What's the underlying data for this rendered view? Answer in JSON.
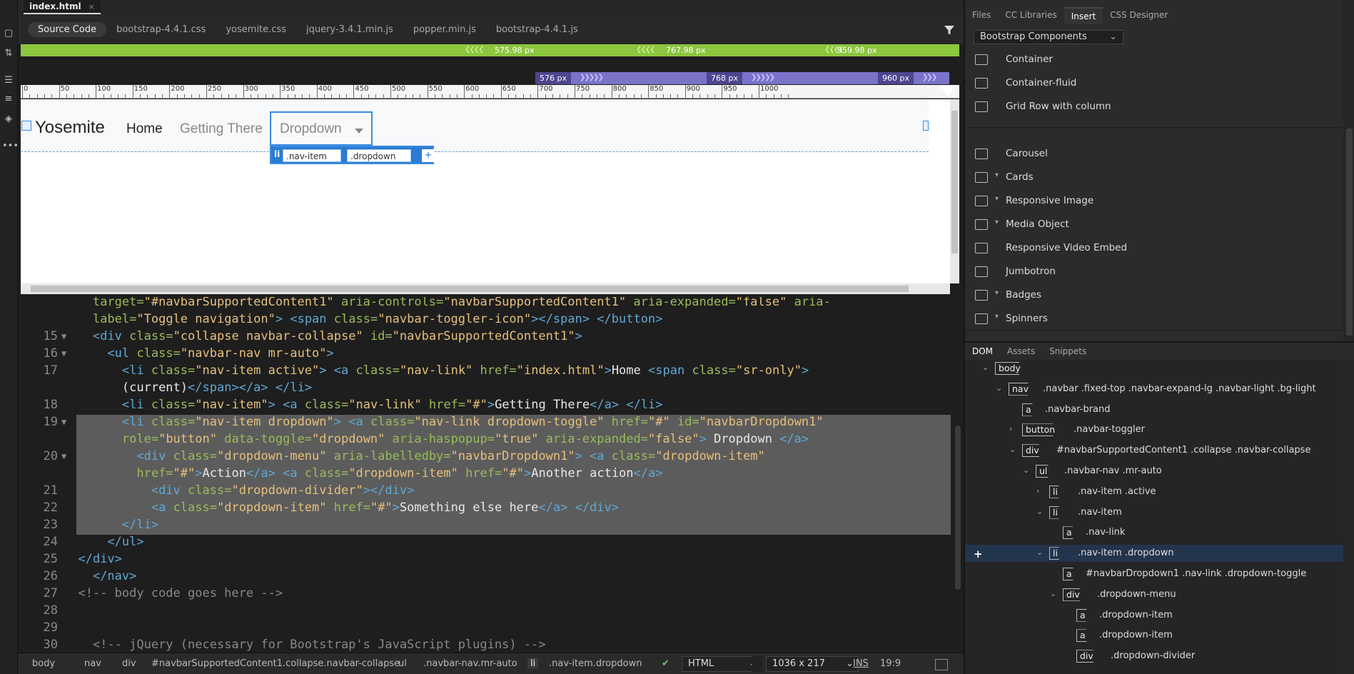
{
  "document": {
    "tab_title": "index.html",
    "close_glyph": "×"
  },
  "related_files": [
    "Source Code",
    "bootstrap-4.4.1.css",
    "yosemite.css",
    "jquery-3.4.1.min.js",
    "popper.min.js",
    "bootstrap-4.4.1.js"
  ],
  "media_queries": {
    "min_width": [
      "575.98  px",
      "767.98  px",
      "959.98  px"
    ],
    "max_width": [
      "576  px",
      "768  px",
      "960  px"
    ]
  },
  "ruler_labels": [
    "0",
    "50",
    "100",
    "150",
    "200",
    "250",
    "300",
    "350",
    "400",
    "450",
    "500",
    "550",
    "600",
    "650",
    "700",
    "750",
    "800",
    "850",
    "900",
    "950",
    "1000"
  ],
  "live_view": {
    "brand": "Yosemite",
    "nav": [
      "Home",
      "Getting There",
      "Dropdown"
    ],
    "hud": {
      "tag": "li",
      "classes": [
        ".nav-item",
        ".dropdown"
      ],
      "add": "+"
    }
  },
  "code_lines": [
    {
      "num": "",
      "fold": "",
      "html": "    <span class='at'>target=</span><span class='st'>\"#navbarSupportedContent1\"</span> <span class='at'>aria-controls=</span><span class='st'>\"navbarSupportedContent1\"</span> <span class='at'>aria-expanded=</span><span class='st'>\"false\"</span> <span class='at'>aria-</span>"
    },
    {
      "num": "",
      "fold": "",
      "html": "    <span class='at'>label=</span><span class='st'>\"Toggle navigation\"</span><span class='tg'>&gt;</span> <span class='tg'>&lt;span</span> <span class='at'>class=</span><span class='st'>\"navbar-toggler-icon\"</span><span class='tg'>&gt;&lt;/span&gt;</span> <span class='tg'>&lt;/button&gt;</span>"
    },
    {
      "num": "15",
      "fold": "▼",
      "html": "    <span class='tg'>&lt;div</span> <span class='at'>class=</span><span class='st'>\"collapse navbar-collapse\"</span> <span class='at'>id=</span><span class='st'>\"navbarSupportedContent1\"</span><span class='tg'>&gt;</span>"
    },
    {
      "num": "16",
      "fold": "▼",
      "html": "      <span class='tg'>&lt;ul</span> <span class='at'>class=</span><span class='st'>\"navbar-nav mr-auto\"</span><span class='tg'>&gt;</span>"
    },
    {
      "num": "17",
      "fold": "",
      "html": "        <span class='tg'>&lt;li</span> <span class='at'>class=</span><span class='st'>\"nav-item active\"</span><span class='tg'>&gt;</span> <span class='tg'>&lt;a</span> <span class='at'>class=</span><span class='st'>\"nav-link\"</span> <span class='at'>href=</span><span class='st'>\"index.html\"</span><span class='tg'>&gt;</span><span class='tx'>Home </span><span class='tg'>&lt;span</span> <span class='at'>class=</span><span class='st'>\"sr-only\"</span><span class='tg'>&gt;</span>"
    },
    {
      "num": "",
      "fold": "",
      "html": "        <span class='tx'>(current)</span><span class='tg'>&lt;/span&gt;&lt;/a&gt;</span> <span class='tg'>&lt;/li&gt;</span>"
    },
    {
      "num": "18",
      "fold": "",
      "html": "        <span class='tg'>&lt;li</span> <span class='at'>class=</span><span class='st'>\"nav-item\"</span><span class='tg'>&gt;</span> <span class='tg'>&lt;a</span> <span class='at'>class=</span><span class='st'>\"nav-link\"</span> <span class='at'>href=</span><span class='st'>\"#\"</span><span class='tg'>&gt;</span><span class='tx'>Getting There</span><span class='tg'>&lt;/a&gt;</span> <span class='tg'>&lt;/li&gt;</span>"
    },
    {
      "num": "19",
      "fold": "▼",
      "html": "        <span class='tg'>&lt;li</span> <span class='at'>class=</span><span class='st'>\"nav-item dropdown\"</span><span class='tg'>&gt;</span> <span class='tg'>&lt;a</span> <span class='at'>class=</span><span class='st'>\"nav-link dropdown-toggle\"</span> <span class='at'>href=</span><span class='st'>\"#\"</span> <span class='at'>id=</span><span class='st'>\"navbarDropdown1\"</span>"
    },
    {
      "num": "",
      "fold": "",
      "html": "        <span class='at'>role=</span><span class='st'>\"button\"</span> <span class='at'>data-toggle=</span><span class='st'>\"dropdown\"</span> <span class='at'>aria-haspopup=</span><span class='st'>\"true\"</span> <span class='at'>aria-expanded=</span><span class='st'>\"false\"</span><span class='tg'>&gt;</span><span class='tx'> Dropdown </span><span class='tg'>&lt;/a&gt;</span>"
    },
    {
      "num": "20",
      "fold": "▼",
      "html": "          <span class='tg'>&lt;div</span> <span class='at'>class=</span><span class='st'>\"dropdown-menu\"</span> <span class='at'>aria-labelledby=</span><span class='st'>\"navbarDropdown1\"</span><span class='tg'>&gt;</span> <span class='tg'>&lt;a</span> <span class='at'>class=</span><span class='st'>\"dropdown-item\"</span>"
    },
    {
      "num": "",
      "fold": "",
      "html": "          <span class='at'>href=</span><span class='st'>\"#\"</span><span class='tg'>&gt;</span><span class='tx'>Action</span><span class='tg'>&lt;/a&gt;</span> <span class='tg'>&lt;a</span> <span class='at'>class=</span><span class='st'>\"dropdown-item\"</span> <span class='at'>href=</span><span class='st'>\"#\"</span><span class='tg'>&gt;</span><span class='tx'>Another action</span><span class='tg'>&lt;/a&gt;</span>"
    },
    {
      "num": "21",
      "fold": "",
      "html": "            <span class='tg'>&lt;div</span> <span class='at'>class=</span><span class='st'>\"dropdown-divider\"</span><span class='tg'>&gt;&lt;/div&gt;</span>"
    },
    {
      "num": "22",
      "fold": "",
      "html": "            <span class='tg'>&lt;a</span> <span class='at'>class=</span><span class='st'>\"dropdown-item\"</span> <span class='at'>href=</span><span class='st'>\"#\"</span><span class='tg'>&gt;</span><span class='tx'>Something else here</span><span class='tg'>&lt;/a&gt;</span> <span class='tg'>&lt;/div&gt;</span>"
    },
    {
      "num": "23",
      "fold": "",
      "html": "        <span class='tg'>&lt;/li&gt;</span>"
    },
    {
      "num": "24",
      "fold": "",
      "html": "      <span class='tg'>&lt;/ul&gt;</span>"
    },
    {
      "num": "25",
      "fold": "",
      "html": "  <span class='tg'>&lt;/div&gt;</span>"
    },
    {
      "num": "26",
      "fold": "",
      "html": "    <span class='tg'>&lt;/nav&gt;</span>"
    },
    {
      "num": "27",
      "fold": "",
      "html": "  <span class='cm'>&lt;!-- body code goes here --&gt;</span>"
    },
    {
      "num": "28",
      "fold": "",
      "html": ""
    },
    {
      "num": "29",
      "fold": "",
      "html": ""
    },
    {
      "num": "30",
      "fold": "",
      "html": "    <span class='cm'>&lt;!-- jQuery (necessary for Bootstrap's JavaScript plugins) --&gt;</span>"
    }
  ],
  "status_bar": {
    "breadcrumbs": [
      "body",
      "nav",
      "div",
      "#navbarSupportedContent1.collapse.navbar-collapse",
      "ul",
      ".navbar-nav.mr-auto",
      "li",
      ".nav-item.dropdown"
    ],
    "language": "HTML",
    "window_size": "1036 x 217",
    "mode": "INS",
    "cursor": "19:9"
  },
  "right_panel": {
    "tabs": [
      "Files",
      "CC Libraries",
      "Insert",
      "CSS Designer"
    ],
    "active_tab": "Insert",
    "category": "Bootstrap Components",
    "components": [
      {
        "label": "Container",
        "twisty": ""
      },
      {
        "label": "Container-fluid",
        "twisty": ""
      },
      {
        "label": "Grid Row with column",
        "twisty": ""
      },
      {
        "label": "Carousel",
        "twisty": ""
      },
      {
        "label": "Cards",
        "twisty": "▾"
      },
      {
        "label": "Responsive Image",
        "twisty": "▾"
      },
      {
        "label": "Media Object",
        "twisty": "▾"
      },
      {
        "label": "Responsive Video Embed",
        "twisty": ""
      },
      {
        "label": "Jumbotron",
        "twisty": ""
      },
      {
        "label": "Badges",
        "twisty": "▾"
      },
      {
        "label": "Spinners",
        "twisty": "▾"
      }
    ]
  },
  "dom_panel": {
    "tabs": [
      "DOM",
      "Assets",
      "Snippets"
    ],
    "nodes": [
      {
        "tag": "body",
        "sel": "",
        "twisty": "⌄",
        "depth": 0
      },
      {
        "tag": "nav",
        "sel": ".navbar .fixed-top .navbar-expand-lg .navbar-light .bg-light",
        "twisty": "⌄",
        "depth": 1
      },
      {
        "tag": "a",
        "sel": ".navbar-brand",
        "twisty": "",
        "depth": 2
      },
      {
        "tag": "button",
        "sel": ".navbar-toggler",
        "twisty": "›",
        "depth": 2
      },
      {
        "tag": "div",
        "sel": "#navbarSupportedContent1 .collapse .navbar-collapse",
        "twisty": "⌄",
        "depth": 2
      },
      {
        "tag": "ul",
        "sel": ".navbar-nav .mr-auto",
        "twisty": "⌄",
        "depth": 3
      },
      {
        "tag": "li",
        "sel": ".nav-item .active",
        "twisty": "›",
        "depth": 4
      },
      {
        "tag": "li",
        "sel": ".nav-item",
        "twisty": "⌄",
        "depth": 4
      },
      {
        "tag": "a",
        "sel": ".nav-link",
        "twisty": "",
        "depth": 5
      },
      {
        "tag": "li",
        "sel": ".nav-item .dropdown",
        "twisty": "⌄",
        "depth": 4
      },
      {
        "tag": "a",
        "sel": "#navbarDropdown1 .nav-link .dropdown-toggle",
        "twisty": "",
        "depth": 5
      },
      {
        "tag": "div",
        "sel": ".dropdown-menu",
        "twisty": "⌄",
        "depth": 5
      },
      {
        "tag": "a",
        "sel": ".dropdown-item",
        "twisty": "",
        "depth": 6
      },
      {
        "tag": "a",
        "sel": ".dropdown-item",
        "twisty": "",
        "depth": 6
      },
      {
        "tag": "div",
        "sel": ".dropdown-divider",
        "twisty": "",
        "depth": 6
      }
    ]
  },
  "colors": {
    "mq_min": "#8dc63f",
    "mq_max": "#7b73c9",
    "selection": "#3b8be0"
  }
}
